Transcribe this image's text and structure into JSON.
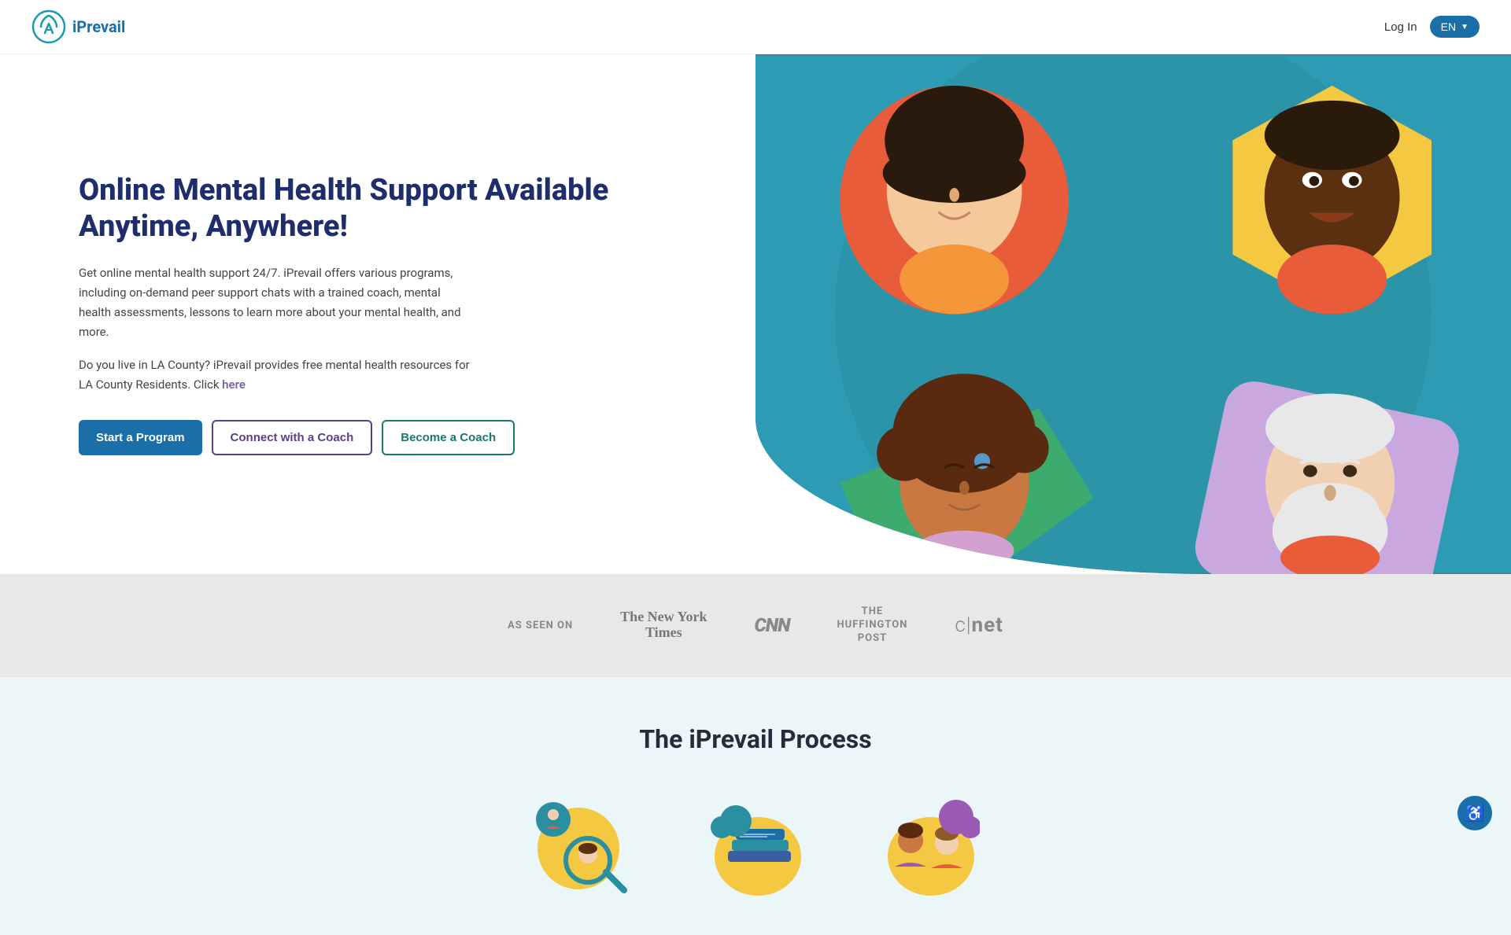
{
  "nav": {
    "logo_text": "iPrevail",
    "login_label": "Log In",
    "lang_label": "EN"
  },
  "hero": {
    "title": "Online Mental Health Support Available Anytime, Anywhere!",
    "description": "Get online mental health support 24/7. iPrevail offers various programs, including on-demand peer support chats with a trained coach, mental health assessments, lessons to learn more about your mental health, and more.",
    "la_text_before": "Do you live in LA County? iPrevail provides free mental health resources for LA County Residents. Click ",
    "la_link_text": "here",
    "la_text_after": "",
    "btn_start": "Start a Program",
    "btn_connect": "Connect with a Coach",
    "btn_become": "Become a Coach"
  },
  "as_seen_on": {
    "label": "AS SEEN ON",
    "logos": [
      {
        "name": "The New York Times",
        "line1": "The New York",
        "line2": "Times"
      },
      {
        "name": "CNN",
        "text": "CNN"
      },
      {
        "name": "The Huffington Post",
        "line1": "THE",
        "line2": "HUFFINGTON",
        "line3": "POST"
      },
      {
        "name": "CNET",
        "text": "c|net"
      }
    ]
  },
  "process": {
    "title": "The iPrevail Process",
    "cards": [
      {
        "label": "icon-1"
      },
      {
        "label": "icon-2"
      },
      {
        "label": "icon-3"
      }
    ]
  },
  "accessibility": {
    "icon": "♿"
  }
}
